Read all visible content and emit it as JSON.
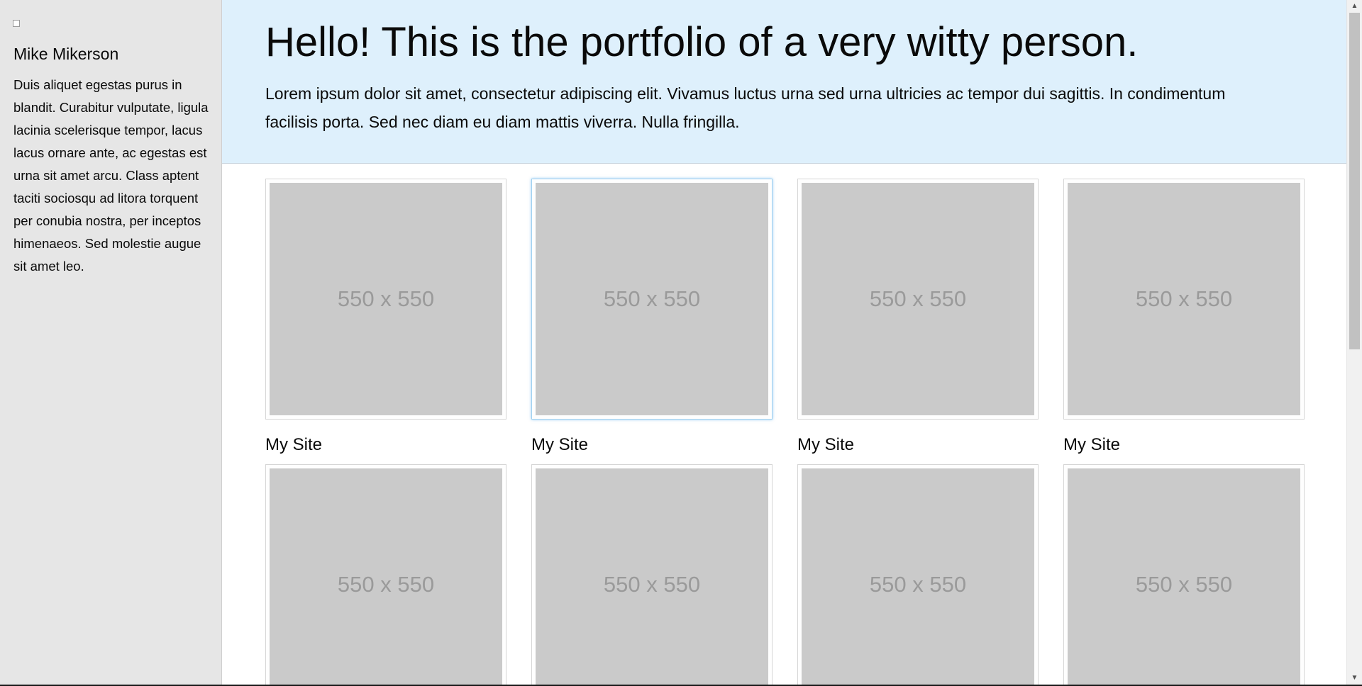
{
  "sidebar": {
    "name": "Mike Mikerson",
    "bio": "Duis aliquet egestas purus in blandit. Curabitur vulputate, ligula lacinia scelerisque tempor, lacus lacus ornare ante, ac egestas est urna sit amet arcu. Class aptent taciti sociosqu ad litora torquent per conubia nostra, per inceptos himenaeos. Sed molestie augue sit amet leo."
  },
  "hero": {
    "title": "Hello! This is the portfolio of a very witty person.",
    "text": "Lorem ipsum dolor sit amet, consectetur adipiscing elit. Vivamus luctus urna sed urna ultricies ac tempor dui sagittis. In condimentum facilisis porta. Sed nec diam eu diam mattis viverra. Nulla fringilla."
  },
  "portfolio": {
    "items": [
      {
        "placeholder": "550 x 550",
        "caption": "My Site"
      },
      {
        "placeholder": "550 x 550",
        "caption": "My Site"
      },
      {
        "placeholder": "550 x 550",
        "caption": "My Site"
      },
      {
        "placeholder": "550 x 550",
        "caption": "My Site"
      },
      {
        "placeholder": "550 x 550",
        "caption": ""
      },
      {
        "placeholder": "550 x 550",
        "caption": ""
      },
      {
        "placeholder": "550 x 550",
        "caption": ""
      },
      {
        "placeholder": "550 x 550",
        "caption": ""
      }
    ]
  },
  "icons": {
    "scroll_up": "scroll-up-arrow-icon",
    "scroll_down": "scroll-down-arrow-icon"
  },
  "colors": {
    "sidebar_bg": "#e6e6e6",
    "hero_bg": "#def0fc",
    "placeholder_bg": "#cacaca",
    "placeholder_text": "#9a9a9a",
    "focus_ring": "#9fd0f0"
  }
}
